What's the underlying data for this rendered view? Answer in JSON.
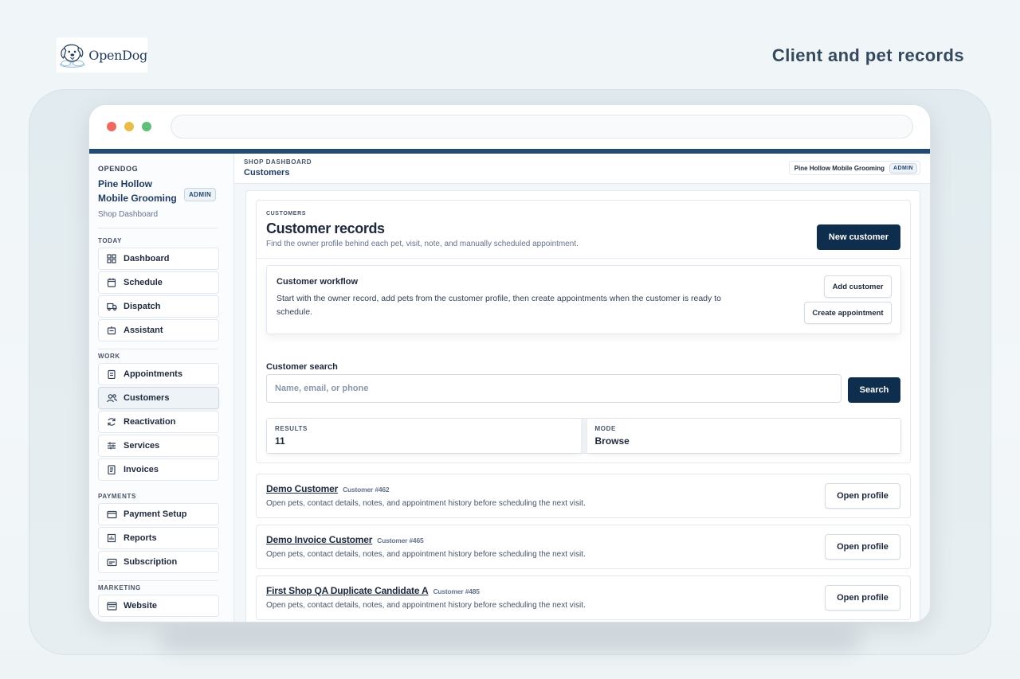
{
  "brand": {
    "logo_text": "OpenDog"
  },
  "headline": "Client and pet records",
  "sidebar": {
    "eyebrow": "OPENDOG",
    "shop_name": "Pine Hollow Mobile Grooming",
    "role_badge": "ADMIN",
    "subtitle": "Shop Dashboard",
    "sections": [
      {
        "title": "TODAY",
        "items": [
          {
            "label": "Dashboard",
            "icon": "dashboard-icon"
          },
          {
            "label": "Schedule",
            "icon": "calendar-icon"
          },
          {
            "label": "Dispatch",
            "icon": "truck-icon"
          },
          {
            "label": "Assistant",
            "icon": "bot-icon"
          }
        ]
      },
      {
        "title": "WORK",
        "items": [
          {
            "label": "Appointments",
            "icon": "clipboard-icon"
          },
          {
            "label": "Customers",
            "icon": "users-icon",
            "active": true
          },
          {
            "label": "Reactivation",
            "icon": "refresh-icon"
          },
          {
            "label": "Services",
            "icon": "sliders-icon"
          },
          {
            "label": "Invoices",
            "icon": "document-icon"
          }
        ]
      },
      {
        "title": "PAYMENTS",
        "items": [
          {
            "label": "Payment Setup",
            "icon": "credit-card-icon"
          },
          {
            "label": "Reports",
            "icon": "bar-chart-icon"
          },
          {
            "label": "Subscription",
            "icon": "card-icon"
          }
        ]
      },
      {
        "title": "MARKETING",
        "items": [
          {
            "label": "Website",
            "icon": "browser-icon"
          }
        ]
      }
    ]
  },
  "topbar": {
    "eyebrow": "SHOP DASHBOARD",
    "title": "Customers",
    "shop_pill": "Pine Hollow Mobile Grooming",
    "role_badge": "ADMIN"
  },
  "hero": {
    "eyebrow": "CUSTOMERS",
    "title": "Customer records",
    "subtitle": "Find the owner profile behind each pet, visit, note, and manually scheduled appointment.",
    "new_button": "New customer"
  },
  "workflow": {
    "title": "Customer workflow",
    "text": "Start with the owner record, add pets from the customer profile, then create appointments when the customer is ready to schedule.",
    "add_customer": "Add customer",
    "create_appointment": "Create appointment"
  },
  "search": {
    "label": "Customer search",
    "placeholder": "Name, email, or phone",
    "value": "",
    "button": "Search"
  },
  "stats": {
    "results_label": "RESULTS",
    "results_value": "11",
    "mode_label": "MODE",
    "mode_value": "Browse"
  },
  "customers": [
    {
      "name": "Demo Customer",
      "id": "Customer #462",
      "desc": "Open pets, contact details, notes, and appointment history before scheduling the next visit.",
      "action": "Open profile"
    },
    {
      "name": "Demo Invoice Customer",
      "id": "Customer #465",
      "desc": "Open pets, contact details, notes, and appointment history before scheduling the next visit.",
      "action": "Open profile"
    },
    {
      "name": "First Shop QA Duplicate Candidate A",
      "id": "Customer #485",
      "desc": "Open pets, contact details, notes, and appointment history before scheduling the next visit.",
      "action": "Open profile"
    }
  ],
  "colors": {
    "accent": "#234a73",
    "primary_button": "#0f2d4d",
    "window_red": "#ec6a5e",
    "window_yellow": "#e9bd4c",
    "window_green": "#5fbf7a"
  }
}
